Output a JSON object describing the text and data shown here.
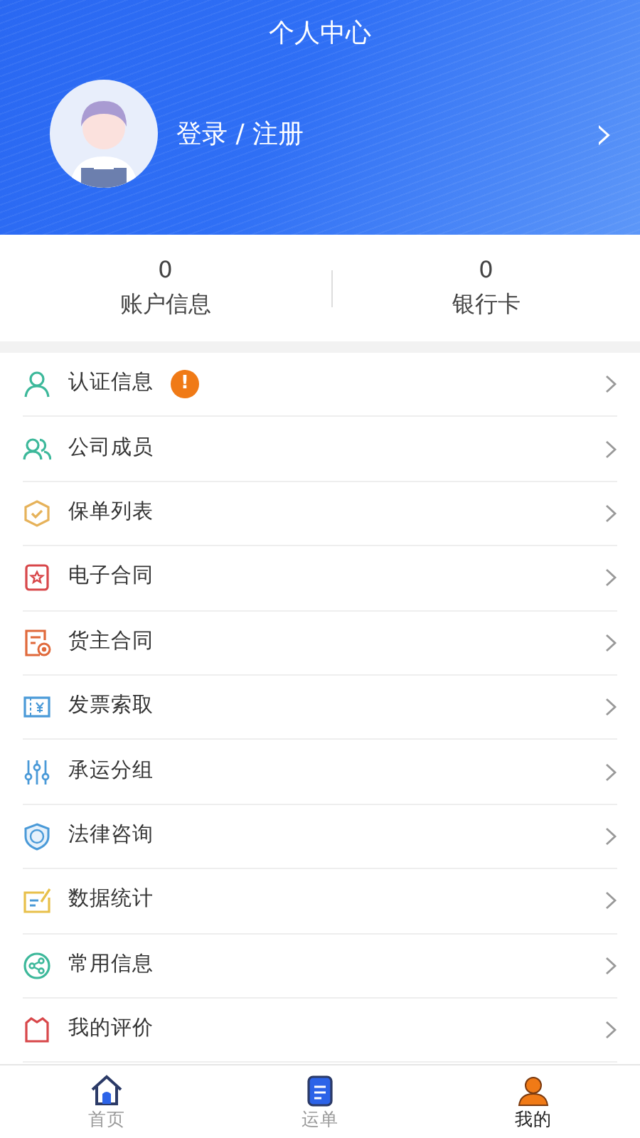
{
  "header": {
    "title": "个人中心",
    "login_text": "登录 / 注册",
    "chevron": "›"
  },
  "stats": [
    {
      "value": "0",
      "label": "账户信息"
    },
    {
      "value": "0",
      "label": "银行卡"
    }
  ],
  "menu": [
    {
      "label": "认证信息",
      "badge": "!"
    },
    {
      "label": "公司成员"
    },
    {
      "label": "保单列表"
    },
    {
      "label": "电子合同"
    },
    {
      "label": "货主合同"
    },
    {
      "label": "发票索取"
    },
    {
      "label": "承运分组"
    },
    {
      "label": "法律咨询"
    },
    {
      "label": "数据统计"
    },
    {
      "label": "常用信息"
    },
    {
      "label": "我的评价"
    }
  ],
  "tabs": [
    {
      "label": "首页",
      "selected": false
    },
    {
      "label": "运单",
      "selected": false
    },
    {
      "label": "我的",
      "selected": true
    }
  ]
}
